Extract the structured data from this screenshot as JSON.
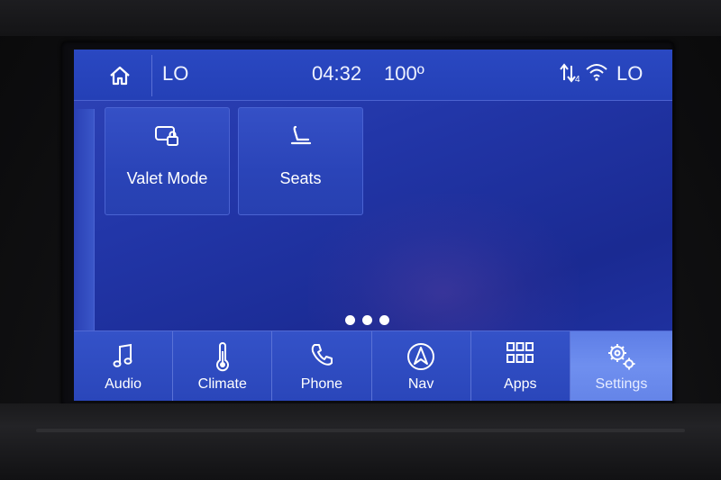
{
  "status": {
    "left_level": "LO",
    "time": "04:32",
    "temperature": "100º",
    "right_level": "LO"
  },
  "tiles": [
    {
      "label": "Valet Mode",
      "icon": "valet-lock-icon"
    },
    {
      "label": "Seats",
      "icon": "seat-icon"
    }
  ],
  "pager": {
    "pages": 3
  },
  "nav": [
    {
      "label": "Audio",
      "icon": "music-note-icon"
    },
    {
      "label": "Climate",
      "icon": "thermometer-icon"
    },
    {
      "label": "Phone",
      "icon": "phone-icon"
    },
    {
      "label": "Nav",
      "icon": "compass-arrow-icon"
    },
    {
      "label": "Apps",
      "icon": "grid-icon"
    },
    {
      "label": "Settings",
      "icon": "gear-icon",
      "active": true
    }
  ],
  "colors": {
    "screen": "#2236a8",
    "active_tab": "#6f8fef",
    "text": "#ffffff"
  }
}
